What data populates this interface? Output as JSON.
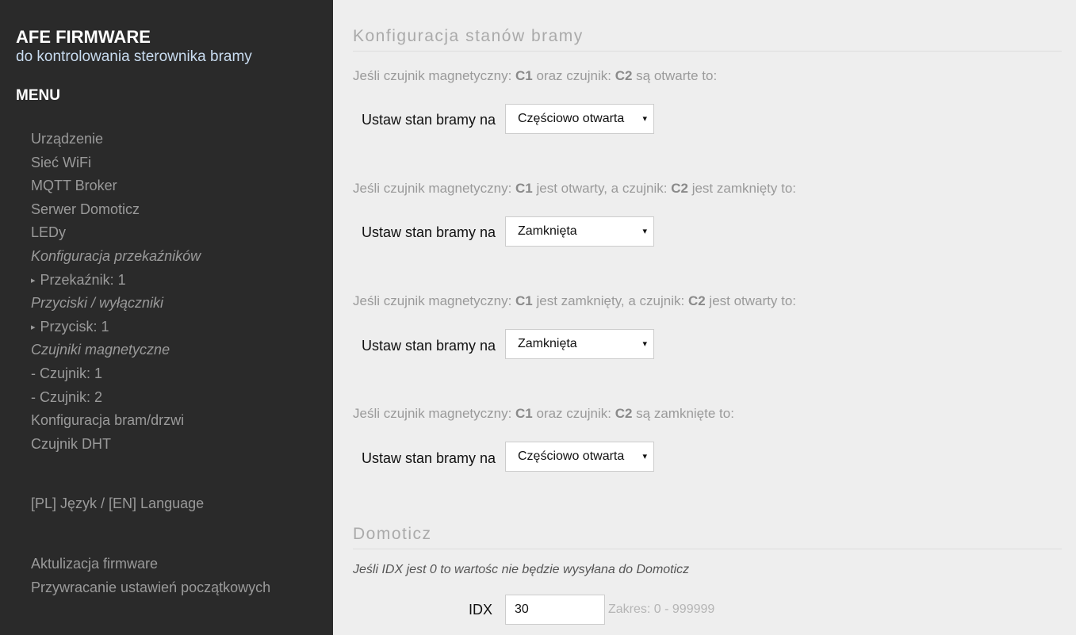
{
  "sidebar": {
    "title": "AFE FIRMWARE",
    "subtitle": "do kontrolowania sterownika bramy",
    "menu_title": "MENU",
    "items": [
      {
        "label": "Urządzenie",
        "section": false,
        "bullet": ""
      },
      {
        "label": "Sieć WiFi",
        "section": false,
        "bullet": ""
      },
      {
        "label": "MQTT Broker",
        "section": false,
        "bullet": ""
      },
      {
        "label": "Serwer Domoticz",
        "section": false,
        "bullet": ""
      },
      {
        "label": "LEDy",
        "section": false,
        "bullet": ""
      },
      {
        "label": "Konfiguracja przekaźników",
        "section": true,
        "bullet": ""
      },
      {
        "label": "Przekaźnik: 1",
        "section": false,
        "bullet": "▸"
      },
      {
        "label": "Przyciski / wyłączniki",
        "section": true,
        "bullet": ""
      },
      {
        "label": "Przycisk: 1",
        "section": false,
        "bullet": "▸"
      },
      {
        "label": "Czujniki magnetyczne",
        "section": true,
        "bullet": ""
      },
      {
        "label": "- Czujnik: 1",
        "section": false,
        "bullet": ""
      },
      {
        "label": "- Czujnik: 2",
        "section": false,
        "bullet": ""
      },
      {
        "label": "Konfiguracja bram/drzwi",
        "section": false,
        "bullet": ""
      },
      {
        "label": "Czujnik DHT",
        "section": false,
        "bullet": ""
      }
    ],
    "language": "[PL] Język / [EN] Language",
    "firmware_update": "Aktulizacja firmware",
    "factory_reset": "Przywracanie ustawień początkowych"
  },
  "main": {
    "section_title": "Konfiguracja stanów bramy",
    "row_label": "Ustaw stan bramy na",
    "conditions": [
      {
        "p1": "Jeśli czujnik magnetyczny: ",
        "s1": "C1",
        "p2": " oraz czujnik: ",
        "s2": "C2",
        "p3": " są otwarte to:",
        "value": "Częściowo otwarta"
      },
      {
        "p1": "Jeśli czujnik magnetyczny: ",
        "s1": "C1",
        "p2": " jest otwarty, a czujnik: ",
        "s2": "C2",
        "p3": " jest zamknięty to:",
        "value": "Zamknięta"
      },
      {
        "p1": "Jeśli czujnik magnetyczny: ",
        "s1": "C1",
        "p2": " jest zamknięty, a czujnik: ",
        "s2": "C2",
        "p3": " jest otwarty to:",
        "value": "Zamknięta"
      },
      {
        "p1": "Jeśli czujnik magnetyczny: ",
        "s1": "C1",
        "p2": " oraz czujnik: ",
        "s2": "C2",
        "p3": " są zamknięte to:",
        "value": "Częściowo otwarta"
      }
    ],
    "caret": "▾"
  },
  "domoticz": {
    "title": "Domoticz",
    "note": "Jeśli IDX jest 0 to wartośc nie będzie wysyłana do Domoticz",
    "idx_label": "IDX",
    "idx_value": "30",
    "range": "Zakres: 0 - 999999"
  }
}
